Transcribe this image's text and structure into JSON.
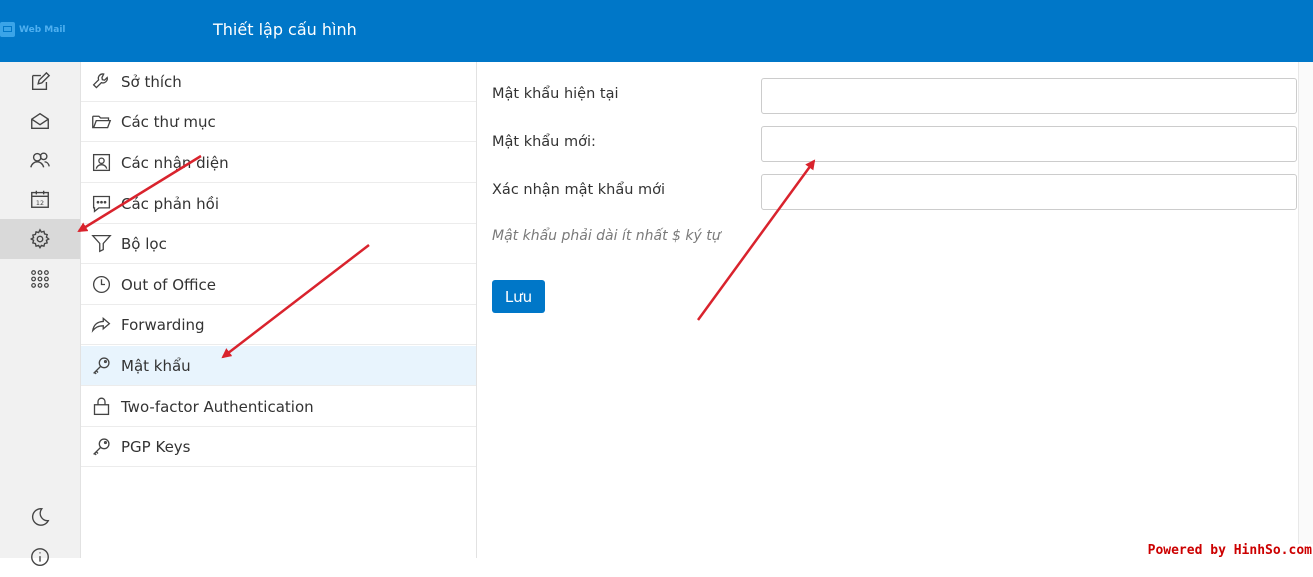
{
  "app": {
    "logo_text": "Web Mail",
    "title": "Thiết lập cấu hình"
  },
  "rail": {
    "items": [
      {
        "name": "compose-icon"
      },
      {
        "name": "mail-icon"
      },
      {
        "name": "contacts-icon"
      },
      {
        "name": "calendar-icon",
        "text": "12"
      },
      {
        "name": "gear-icon",
        "active": true
      },
      {
        "name": "apps-grid-icon"
      },
      {
        "name": "moon-icon"
      },
      {
        "name": "info-icon"
      }
    ]
  },
  "settings": {
    "items": [
      {
        "label": "Sở thích",
        "icon": "wrench-icon"
      },
      {
        "label": "Các thư mục",
        "icon": "folder-open-icon"
      },
      {
        "label": "Các nhận diện",
        "icon": "identity-card-icon"
      },
      {
        "label": "Các phản hồi",
        "icon": "chat-dots-icon"
      },
      {
        "label": "Bộ lọc",
        "icon": "filter-icon"
      },
      {
        "label": "Out of Office",
        "icon": "clock-icon"
      },
      {
        "label": "Forwarding",
        "icon": "share-arrow-icon"
      },
      {
        "label": "Mật khẩu",
        "icon": "key-icon",
        "active": true
      },
      {
        "label": "Two-factor Authentication",
        "icon": "lock-icon"
      },
      {
        "label": "PGP Keys",
        "icon": "key-icon"
      }
    ]
  },
  "form": {
    "current_password_label": "Mật khẩu hiện tại",
    "current_password_value": "",
    "new_password_label": "Mật khẩu mới:",
    "new_password_value": "",
    "confirm_password_label": "Xác nhận mật khẩu mới",
    "confirm_password_value": "",
    "hint": "Mật khẩu phải dài ít nhất $ ký tự",
    "save_label": "Lưu"
  },
  "colors": {
    "header": "#0077c8",
    "accent": "#0077c8",
    "annotation_arrow": "#d9232d",
    "active_item_bg": "#e8f4fd"
  },
  "watermark": "Powered by HinhSo.com"
}
